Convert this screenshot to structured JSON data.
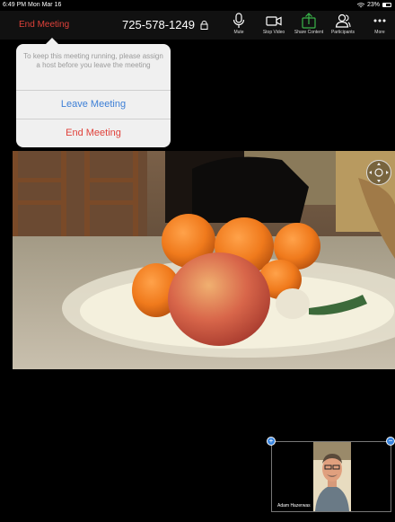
{
  "status_bar": {
    "time_date": "6:49 PM  Mon Mar 16",
    "battery": "23%"
  },
  "toolbar": {
    "end_meeting": "End Meeting",
    "meeting_id": "725-578-1249",
    "buttons": [
      {
        "label": "Mute",
        "icon": "microphone-icon"
      },
      {
        "label": "Stop Video",
        "icon": "video-camera-icon"
      },
      {
        "label": "Share Content",
        "icon": "share-icon"
      },
      {
        "label": "Participants",
        "icon": "participants-icon"
      },
      {
        "label": "More",
        "icon": "more-icon"
      }
    ],
    "share_color": "#3ab54a"
  },
  "popup": {
    "message": "To keep this meeting running, please assign a host before you leave the meeting",
    "leave_label": "Leave Meeting",
    "end_label": "End Meeting"
  },
  "self_view": {
    "name": "Adam Hazerwas"
  },
  "colors": {
    "danger": "#e0413a",
    "link": "#3d7fd6",
    "accent": "#3a86e0"
  }
}
